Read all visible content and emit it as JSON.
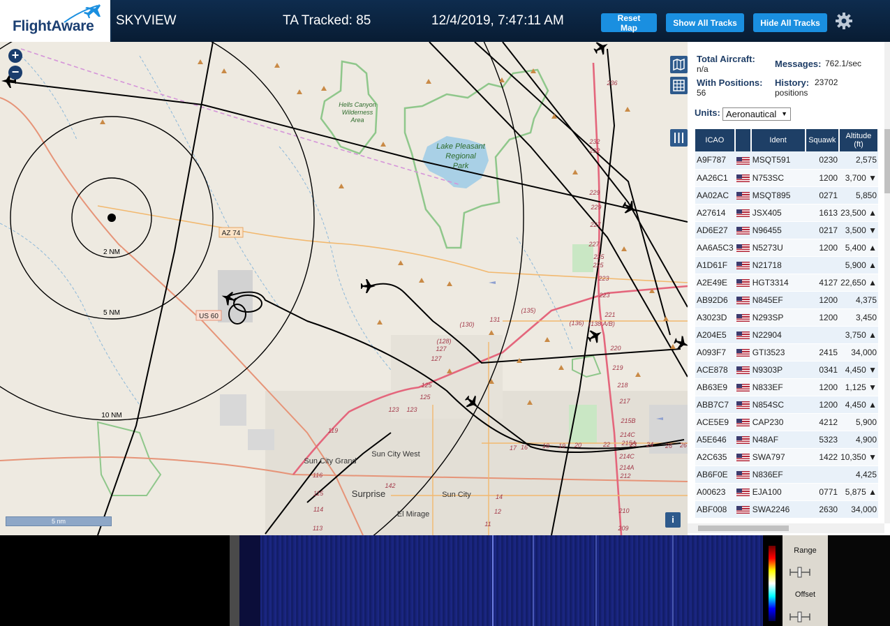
{
  "header": {
    "logo_text": "FlightAware",
    "app_title": "SKYVIEW",
    "tracked": "TA Tracked: 85",
    "clock": "12/4/2019, 7:47:11 AM",
    "buttons": {
      "reset_map": "Reset Map",
      "show_all": "Show All Tracks",
      "hide_all": "Hide All Tracks"
    }
  },
  "map": {
    "labels": {
      "wilderness": [
        "Hells Canyon",
        "Wilderness",
        "Area"
      ],
      "lake": [
        "Lake Pleasant",
        "Regional",
        "Park"
      ],
      "az74": "AZ 74",
      "us60": "US 60",
      "ring_2": "2 NM",
      "ring_5": "5 NM",
      "ring_10": "10 NM",
      "sun_city_grand": "Sun City Grand",
      "sun_city_west": "Sun City West",
      "surprise": "Surprise",
      "sun_city": "Sun City",
      "el_mirage": "El Mirage"
    },
    "road_numbers": [
      "236",
      "232",
      "232",
      "229",
      "229",
      "227",
      "227",
      "225",
      "225",
      "223",
      "223",
      "221",
      "220",
      "219",
      "218",
      "217",
      "215B",
      "214C",
      "215A",
      "214C",
      "214A",
      "212",
      "210",
      "209",
      "131",
      "(130)",
      "(135)",
      "(136)",
      "(138 A/B)",
      "(128)",
      "127",
      "127",
      "125",
      "125",
      "123",
      "123",
      "119",
      "116",
      "115",
      "114",
      "113",
      "142",
      "17",
      "16",
      "18",
      "19",
      "20",
      "22",
      "23",
      "24",
      "26",
      "26",
      "14",
      "12",
      "11"
    ],
    "scale_label": "5 nm",
    "zoom_in": "+",
    "zoom_out": "−",
    "info": "i"
  },
  "sidebar": {
    "total_aircraft_label": "Total Aircraft:",
    "total_aircraft_value": "n/a",
    "with_positions_label": "With Positions:",
    "with_positions_value": "56",
    "messages_label": "Messages:",
    "messages_value": "762.1/sec",
    "history_label": "History:",
    "history_value": "23702",
    "history_unit": "positions",
    "units_label": "Units:",
    "units_value": "Aeronautical"
  },
  "table": {
    "columns": [
      "ICAO",
      "",
      "Ident",
      "Squawk",
      "Altitude (ft)"
    ],
    "rows": [
      {
        "icao": "A9F787",
        "ident": "MSQT591",
        "squawk": "0230",
        "alt": "2,575"
      },
      {
        "icao": "AA26C1",
        "ident": "N753SC",
        "squawk": "1200",
        "alt": "3,700 ▼"
      },
      {
        "icao": "AA02AC",
        "ident": "MSQT895",
        "squawk": "0271",
        "alt": "5,850"
      },
      {
        "icao": "A27614",
        "ident": "JSX405",
        "squawk": "1613",
        "alt": "23,500 ▲"
      },
      {
        "icao": "AD6E27",
        "ident": "N96455",
        "squawk": "0217",
        "alt": "3,500 ▼"
      },
      {
        "icao": "AA6A5C3",
        "ident": "N5273U",
        "squawk": "1200",
        "alt": "5,400 ▲"
      },
      {
        "icao": "A1D61F",
        "ident": "N21718",
        "squawk": "",
        "alt": "5,900 ▲"
      },
      {
        "icao": "A2E49E",
        "ident": "HGT3314",
        "squawk": "4127",
        "alt": "22,650 ▲"
      },
      {
        "icao": "AB92D6",
        "ident": "N845EF",
        "squawk": "1200",
        "alt": "4,375"
      },
      {
        "icao": "A3023D",
        "ident": "N293SP",
        "squawk": "1200",
        "alt": "3,450"
      },
      {
        "icao": "A204E5",
        "ident": "N22904",
        "squawk": "",
        "alt": "3,750 ▲"
      },
      {
        "icao": "A093F7",
        "ident": "GTI3523",
        "squawk": "2415",
        "alt": "34,000"
      },
      {
        "icao": "ACE878",
        "ident": "N9303P",
        "squawk": "0341",
        "alt": "4,450 ▼"
      },
      {
        "icao": "AB63E9",
        "ident": "N833EF",
        "squawk": "1200",
        "alt": "1,125 ▼"
      },
      {
        "icao": "ABB7C7",
        "ident": "N854SC",
        "squawk": "1200",
        "alt": "4,450 ▲"
      },
      {
        "icao": "ACE5E9",
        "ident": "CAP230",
        "squawk": "4212",
        "alt": "5,900"
      },
      {
        "icao": "A5E646",
        "ident": "N48AF",
        "squawk": "5323",
        "alt": "4,900"
      },
      {
        "icao": "A2C635",
        "ident": "SWA797",
        "squawk": "1422",
        "alt": "10,350 ▼"
      },
      {
        "icao": "AB6F0E",
        "ident": "N836EF",
        "squawk": "",
        "alt": "4,425"
      },
      {
        "icao": "A00623",
        "ident": "EJA100",
        "squawk": "0771",
        "alt": "5,875 ▲"
      },
      {
        "icao": "ABF008",
        "ident": "SWA2246",
        "squawk": "2630",
        "alt": "34,000"
      }
    ]
  },
  "waterfall": {
    "range_label": "Range",
    "offset_label": "Offset"
  },
  "colors": {
    "header_bg": "#0e2c4e",
    "button": "#1a8fe0",
    "table_header": "#1e3f66",
    "map_bg": "#eeeae1"
  }
}
